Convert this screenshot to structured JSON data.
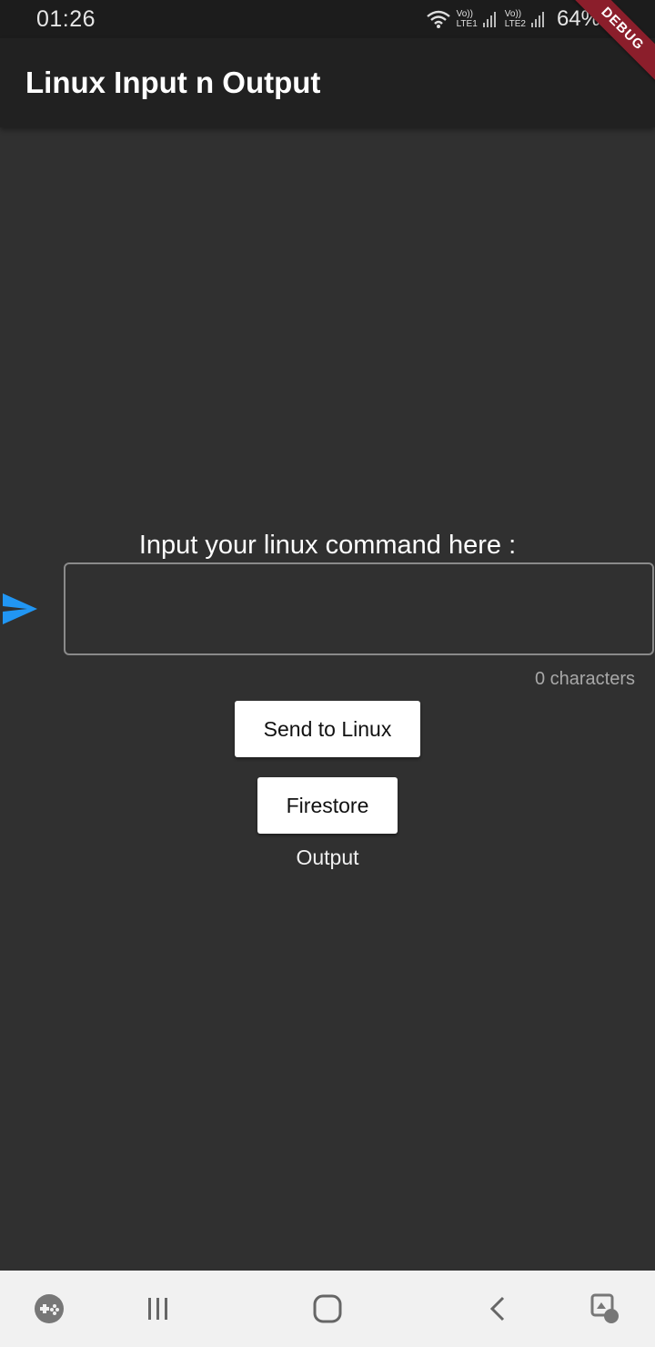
{
  "status_bar": {
    "time": "01:26",
    "sim1_top": "Vo))",
    "sim1_bottom": "LTE1",
    "sim2_top": "Vo))",
    "sim2_bottom": "LTE2",
    "battery": "64%",
    "icons": [
      "wifi-icon",
      "signal-icon",
      "battery-icon"
    ]
  },
  "debug_banner": "DEBUG",
  "app_bar": {
    "title": "Linux Input n Output"
  },
  "main": {
    "prompt_label": "Input your linux command here :",
    "send_icon": "send-icon",
    "command_input": {
      "value": "",
      "placeholder": ""
    },
    "char_counter": "0 characters",
    "send_button_label": "Send to Linux",
    "firestore_button_label": "Firestore",
    "output_label": "Output"
  },
  "nav_bar": {
    "items": [
      "game-launcher-icon",
      "recent-apps-icon",
      "home-icon",
      "back-icon",
      "assistive-touch-icon"
    ]
  },
  "colors": {
    "background": "#303030",
    "app_bar": "#212121",
    "accent": "#2196f3",
    "debug_banner": "#8b1e2b"
  }
}
